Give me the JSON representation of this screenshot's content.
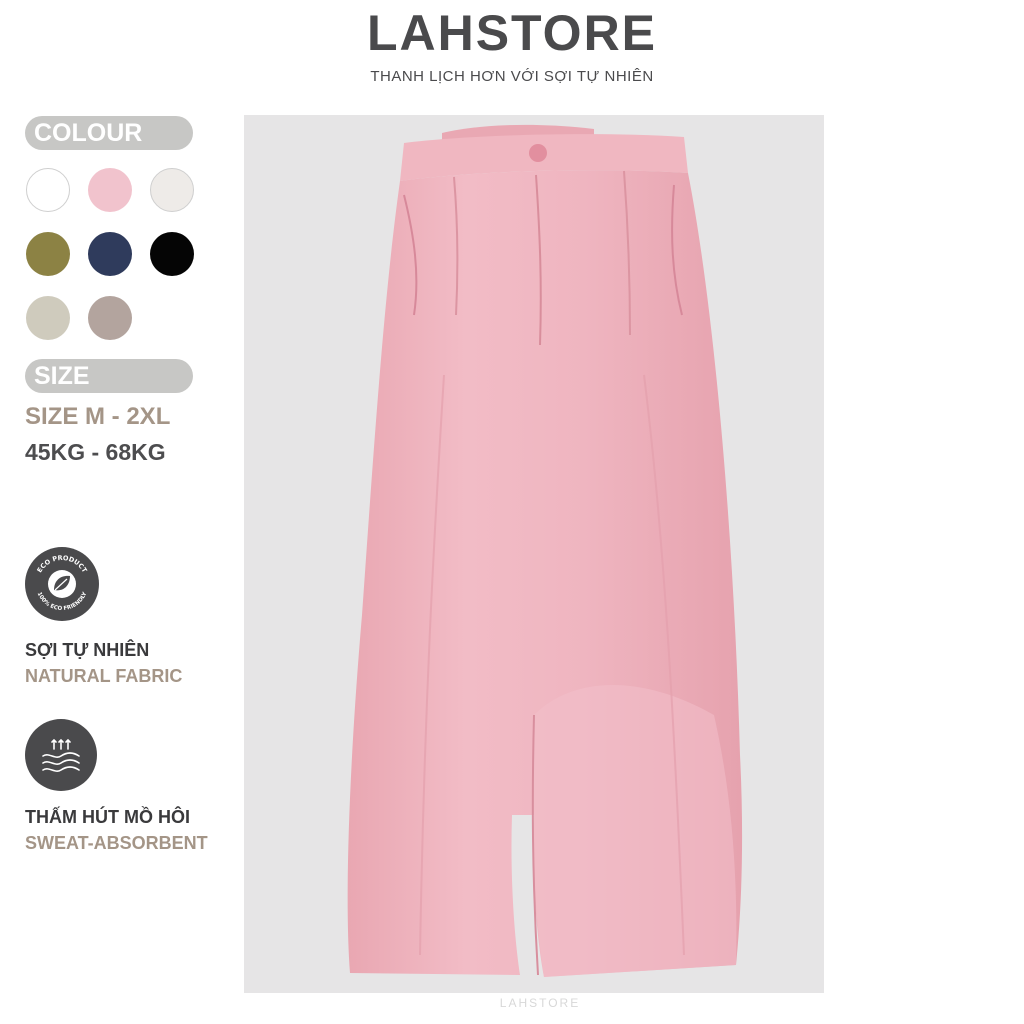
{
  "header": {
    "brand": "LAHSTORE",
    "tagline": "THANH LỊCH HƠN VỚI SỢI TỰ NHIÊN"
  },
  "colour_section": {
    "label": "COLOUR",
    "swatches": [
      {
        "name": "white",
        "color": "#ffffff"
      },
      {
        "name": "pink",
        "color": "#f1c3cd"
      },
      {
        "name": "cream",
        "color": "#eeebe8"
      },
      {
        "name": "olive",
        "color": "#8c8244"
      },
      {
        "name": "navy",
        "color": "#2f3b5c"
      },
      {
        "name": "black",
        "color": "#050505"
      },
      {
        "name": "beige",
        "color": "#cfcbbd"
      },
      {
        "name": "taupe",
        "color": "#b3a49e"
      }
    ]
  },
  "size_section": {
    "label": "SIZE",
    "size_range": "SIZE M - 2XL",
    "weight_range": "45KG - 68KG"
  },
  "features": [
    {
      "icon": "eco-product-icon",
      "badge_text_top": "ECO PRODUCT",
      "badge_text_bottom": "100% ECO FRIENDLY",
      "title_vi": "SỢI TỰ NHIÊN",
      "title_en": "NATURAL FABRIC"
    },
    {
      "icon": "sweat-absorbent-icon",
      "title_vi": "THẤM HÚT MỒ HÔI",
      "title_en": "SWEAT-ABSORBENT"
    }
  ],
  "product_image": {
    "subject": "pink-linen-wide-leg-trousers",
    "background": "#e6e5e6",
    "garment_color": "#eeb3bd"
  },
  "watermark": "LAHSTORE"
}
